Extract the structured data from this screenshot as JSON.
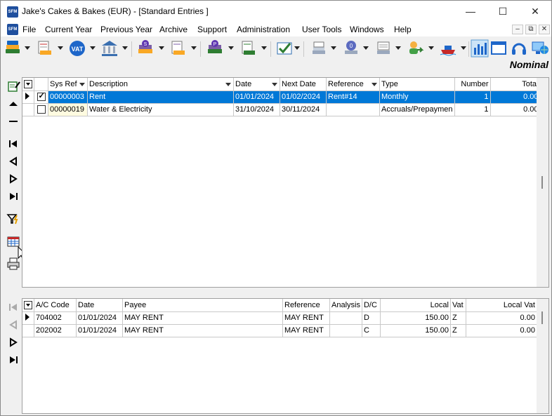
{
  "window": {
    "title": "Jake's Cakes & Bakes (EUR) - [Standard Entries ]",
    "app_icon_text": "SFM",
    "minimize": "—",
    "maximize": "☐",
    "close": "✕"
  },
  "menu": {
    "items": [
      "File",
      "Current Year",
      "Previous Year",
      "Archive",
      "Support",
      "Administration",
      "User Tools",
      "Windows",
      "Help"
    ],
    "mdi_minimize": "–",
    "mdi_restore": "⧉",
    "mdi_close": "✕"
  },
  "toolbar": {
    "vat_label": "VAT",
    "module_label": "Nominal"
  },
  "top_grid": {
    "columns": [
      "Sys Ref",
      "Description",
      "Date",
      "Next Date",
      "Reference",
      "Type",
      "Number",
      "Total"
    ],
    "rows": [
      {
        "checked": true,
        "sys_ref": "00000003",
        "description": "Rent",
        "date": "01/01/2024",
        "next_date": "01/02/2024",
        "reference": "Rent#14",
        "type": "Monthly",
        "number": "1",
        "total": "0.00",
        "selected": true
      },
      {
        "checked": false,
        "sys_ref": "00000019",
        "description": "Water & Electricity",
        "date": "31/10/2024",
        "next_date": "30/11/2024",
        "reference": "",
        "type": "Accruals/Prepaymen",
        "number": "1",
        "total": "0.00",
        "selected": false
      }
    ]
  },
  "bottom_grid": {
    "columns": [
      "A/C Code",
      "Date",
      "Payee",
      "Reference",
      "Analysis",
      "D/C",
      "Local",
      "Vat",
      "Local Vat"
    ],
    "rows": [
      {
        "ac_code": "704002",
        "date": "01/01/2024",
        "payee": "MAY RENT",
        "reference": "MAY RENT",
        "analysis": "",
        "dc": "D",
        "local": "150.00",
        "vat": "Z",
        "local_vat": "0.00"
      },
      {
        "ac_code": "202002",
        "date": "01/01/2024",
        "payee": "MAY RENT",
        "reference": "MAY RENT",
        "analysis": "",
        "dc": "C",
        "local": "150.00",
        "vat": "Z",
        "local_vat": "0.00"
      }
    ]
  },
  "colors": {
    "selection": "#0078d7",
    "window_bg": "#f0f0f0"
  }
}
